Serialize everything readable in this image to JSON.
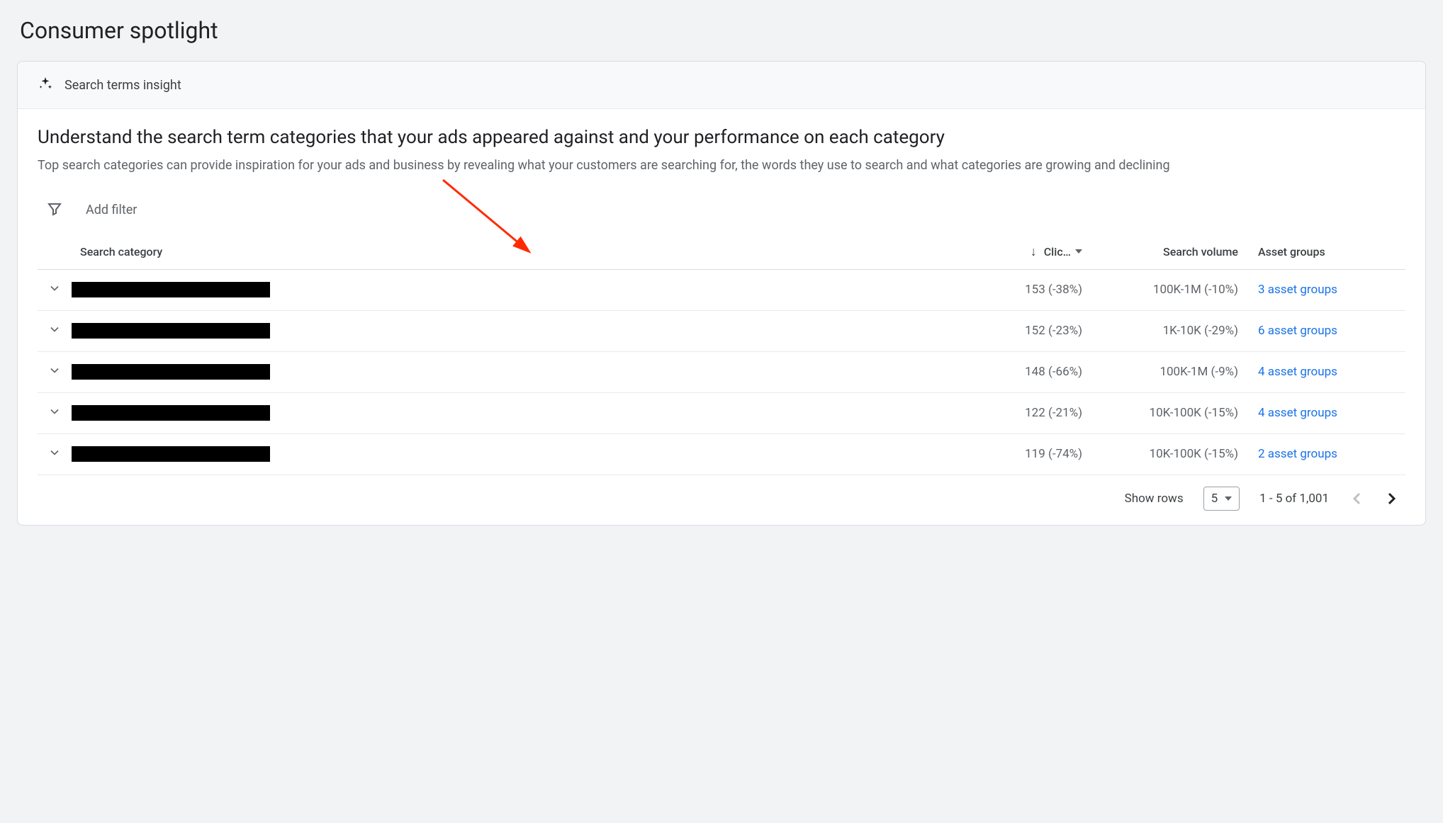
{
  "page": {
    "title": "Consumer spotlight"
  },
  "card": {
    "header_label": "Search terms insight",
    "headline": "Understand the search term categories that your ads appeared against and your performance on each category",
    "subhead": "Top search categories can provide inspiration for your ads and business by revealing what your customers are searching for, the words they use to search and what categories are growing and declining"
  },
  "filter": {
    "add_label": "Add filter"
  },
  "table": {
    "columns": {
      "category": "Search category",
      "clicks": "Clic…",
      "volume": "Search volume",
      "assets": "Asset groups"
    },
    "rows": [
      {
        "clicks": "153 (-38%)",
        "volume": "100K-1M (-10%)",
        "assets": "3 asset groups"
      },
      {
        "clicks": "152 (-23%)",
        "volume": "1K-10K (-29%)",
        "assets": "6 asset groups"
      },
      {
        "clicks": "148 (-66%)",
        "volume": "100K-1M (-9%)",
        "assets": "4 asset groups"
      },
      {
        "clicks": "122 (-21%)",
        "volume": "10K-100K (-15%)",
        "assets": "4 asset groups"
      },
      {
        "clicks": "119 (-74%)",
        "volume": "10K-100K (-15%)",
        "assets": "2 asset groups"
      }
    ]
  },
  "pagination": {
    "show_rows_label": "Show rows",
    "rows_value": "5",
    "range": "1 - 5 of 1,001"
  }
}
